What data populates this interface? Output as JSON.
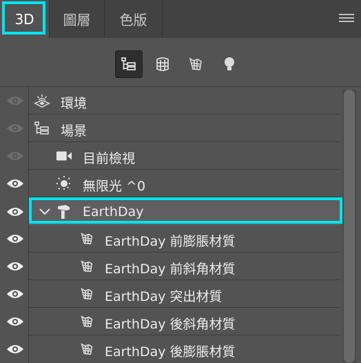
{
  "tabs": [
    {
      "label": "3D"
    },
    {
      "label": "圖層"
    },
    {
      "label": "色版"
    }
  ],
  "filters": [
    {
      "icon": "scene-filter-icon"
    },
    {
      "icon": "mesh-filter-icon"
    },
    {
      "icon": "material-filter-icon"
    },
    {
      "icon": "light-filter-icon"
    }
  ],
  "tree": [
    {
      "label": "環境",
      "icon": "environment-icon"
    },
    {
      "label": "場景",
      "icon": "scene-icon"
    },
    {
      "label": "目前檢視",
      "icon": "camera-icon"
    },
    {
      "label": "無限光 ^0",
      "icon": "infinite-light-icon"
    },
    {
      "label": "EarthDay",
      "icon": "mesh-icon",
      "selected": true,
      "expanded": true
    },
    {
      "label": "EarthDay 前膨脹材質",
      "icon": "material-icon"
    },
    {
      "label": "EarthDay 前斜角材質",
      "icon": "material-icon"
    },
    {
      "label": "EarthDay 突出材質",
      "icon": "material-icon"
    },
    {
      "label": "EarthDay 後斜角材質",
      "icon": "material-icon"
    },
    {
      "label": "EarthDay 後膨脹材質",
      "icon": "material-icon"
    }
  ],
  "colors": {
    "highlight": "#00e5f0",
    "panel": "#535353",
    "selected_row": "#5f5f5f"
  }
}
